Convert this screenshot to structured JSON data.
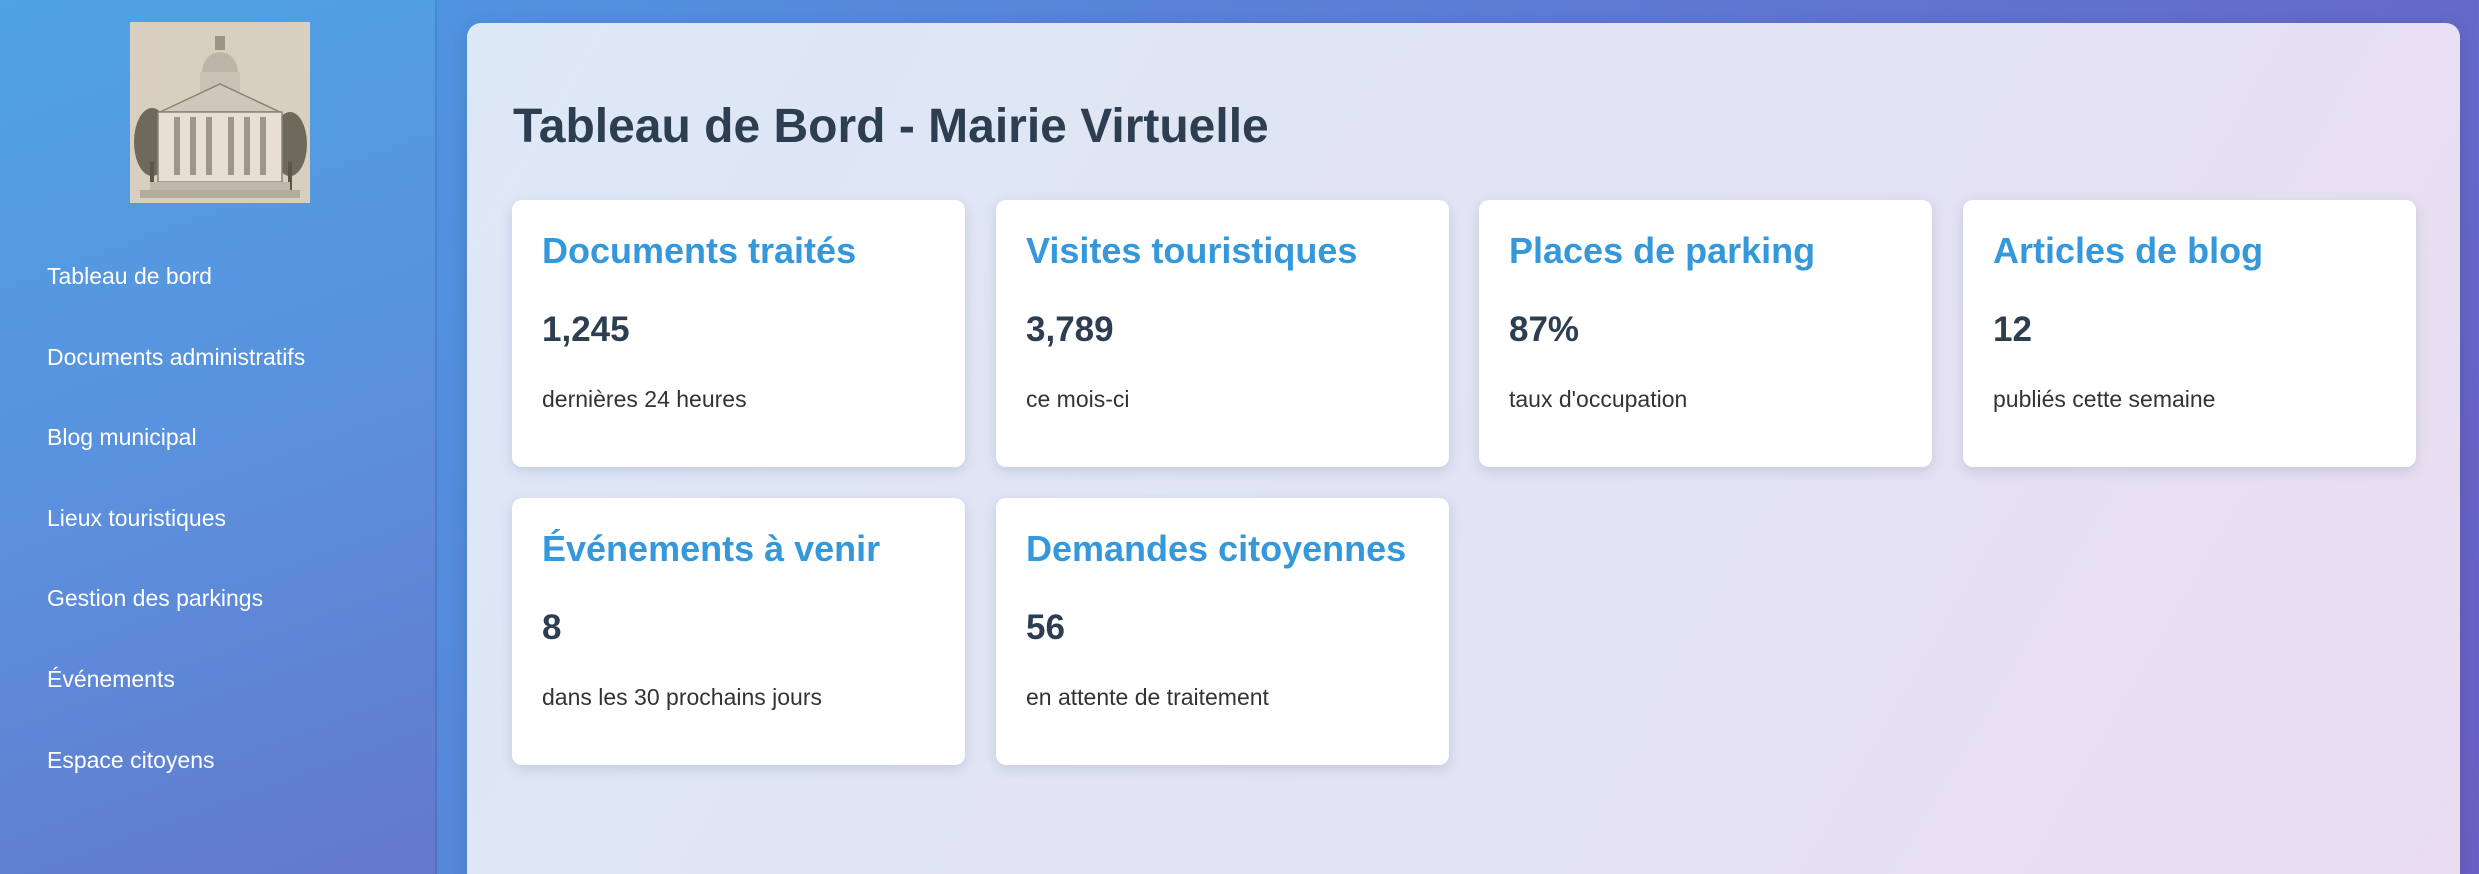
{
  "sidebar": {
    "logo_alt": "Mairie",
    "items": [
      {
        "label": "Tableau de bord"
      },
      {
        "label": "Documents administratifs"
      },
      {
        "label": "Blog municipal"
      },
      {
        "label": "Lieux touristiques"
      },
      {
        "label": "Gestion des parkings"
      },
      {
        "label": "Événements"
      },
      {
        "label": "Espace citoyens"
      }
    ]
  },
  "main": {
    "title": "Tableau de Bord - Mairie Virtuelle",
    "cards": [
      {
        "title": "Documents traités",
        "value": "1,245",
        "desc": "dernières 24 heures"
      },
      {
        "title": "Visites touristiques",
        "value": "3,789",
        "desc": "ce mois-ci"
      },
      {
        "title": "Places de parking",
        "value": "87%",
        "desc": "taux d'occupation"
      },
      {
        "title": "Articles de blog",
        "value": "12",
        "desc": "publiés cette semaine"
      },
      {
        "title": "Événements à venir",
        "value": "8",
        "desc": "dans les 30 prochains jours"
      },
      {
        "title": "Demandes citoyennes",
        "value": "56",
        "desc": "en attente de traitement"
      }
    ]
  },
  "colors": {
    "accent": "#3498db",
    "heading": "#2c3e50"
  }
}
